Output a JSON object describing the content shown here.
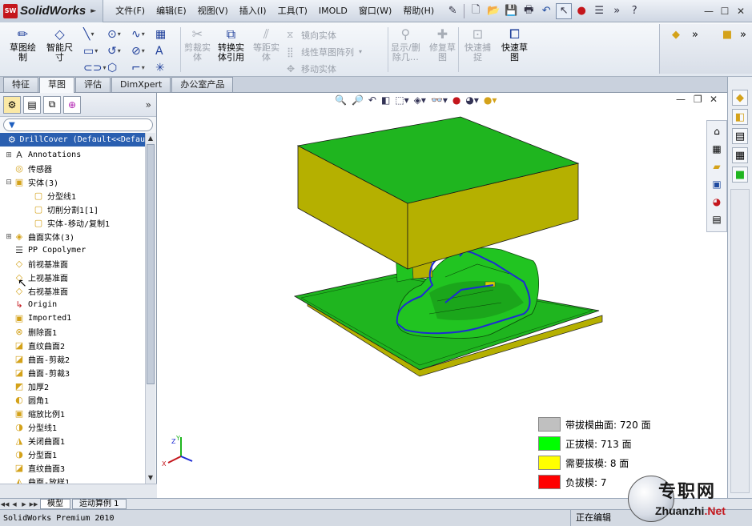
{
  "app": {
    "logo_badge": "SW",
    "logo_text": "SolidWorks"
  },
  "menu": [
    "文件(F)",
    "编辑(E)",
    "视图(V)",
    "插入(I)",
    "工具(T)",
    "IMOLD",
    "窗口(W)",
    "帮助(H)"
  ],
  "ribbon": {
    "sketch_draw": "草图绘\n制",
    "smart_dim": "智能尺\n寸",
    "trim": "剪裁实\n体",
    "convert": "转换实\n体引用",
    "offset": "等距实\n体",
    "mirror": "镜向实体",
    "linear_pattern": "线性草图阵列",
    "move": "移动实体",
    "show_delete": "显示/删\n除几…",
    "repair": "修复草\n图",
    "quick_snap": "快速捕\n捉",
    "rapid_sketch": "快速草\n图"
  },
  "tabs": [
    "特征",
    "草图",
    "评估",
    "DimXpert",
    "办公室产品"
  ],
  "active_tab": "草图",
  "tree": {
    "root": "DrillCover  (Default<<Defau",
    "items": [
      {
        "label": "Annotations",
        "exp": "+",
        "indent": 0
      },
      {
        "label": "传感器",
        "exp": "",
        "indent": 0
      },
      {
        "label": "实体(3)",
        "exp": "−",
        "indent": 0
      },
      {
        "label": "分型线1",
        "exp": "",
        "indent": 1
      },
      {
        "label": "切削分割1[1]",
        "exp": "",
        "indent": 1
      },
      {
        "label": "实体-移动/复制1",
        "exp": "",
        "indent": 1
      },
      {
        "label": "曲面实体(3)",
        "exp": "+",
        "indent": 0
      },
      {
        "label": "PP Copolymer",
        "exp": "",
        "indent": 0
      },
      {
        "label": "前视基准面",
        "exp": "",
        "indent": 0
      },
      {
        "label": "上视基准面",
        "exp": "",
        "indent": 0
      },
      {
        "label": "右视基准面",
        "exp": "",
        "indent": 0
      },
      {
        "label": "Origin",
        "exp": "",
        "indent": 0
      },
      {
        "label": "Imported1",
        "exp": "",
        "indent": 0
      },
      {
        "label": "删除面1",
        "exp": "",
        "indent": 0
      },
      {
        "label": "直纹曲面2",
        "exp": "",
        "indent": 0
      },
      {
        "label": "曲面-剪裁2",
        "exp": "",
        "indent": 0
      },
      {
        "label": "曲面-剪裁3",
        "exp": "",
        "indent": 0
      },
      {
        "label": "加厚2",
        "exp": "",
        "indent": 0
      },
      {
        "label": "圆角1",
        "exp": "",
        "indent": 0
      },
      {
        "label": "缩放比例1",
        "exp": "",
        "indent": 0
      },
      {
        "label": "分型线1",
        "exp": "",
        "indent": 0
      },
      {
        "label": "关闭曲面1",
        "exp": "",
        "indent": 0
      },
      {
        "label": "分型面1",
        "exp": "",
        "indent": 0
      },
      {
        "label": "直纹曲面3",
        "exp": "",
        "indent": 0
      },
      {
        "label": "曲面-放样1",
        "exp": "",
        "indent": 0
      }
    ]
  },
  "legend": [
    {
      "label": "带拔模曲面: 720 面",
      "color": "#c0c0c0"
    },
    {
      "label": "正拔模: 713 面",
      "color": "#00ff00"
    },
    {
      "label": "需要拔模:  8 面",
      "color": "#ffff00"
    },
    {
      "label": "负拔模: 7",
      "color": "#ff0000"
    }
  ],
  "model_colors": {
    "draft_positive": "#1fb51f",
    "draft_needed": "#b5b000",
    "outline": "#1d2bd4"
  },
  "bottom_tabs": [
    "模型",
    "运动算例 1"
  ],
  "status": {
    "product": "SolidWorks Premium 2010",
    "edit": "正在编辑"
  },
  "watermark": {
    "cn": "专职网",
    "en_brand": "Zhuanzhi",
    "en_tld": ".Net"
  }
}
